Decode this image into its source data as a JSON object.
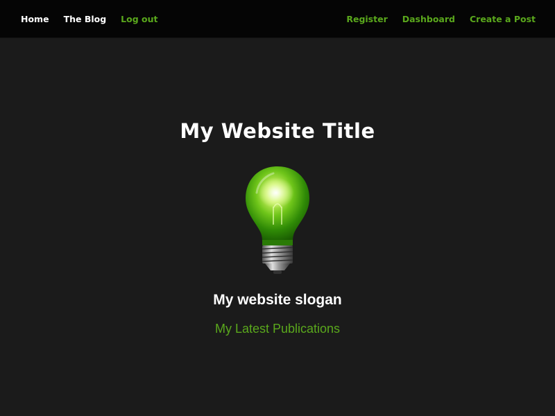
{
  "nav": {
    "left": [
      {
        "label": "Home",
        "color": "#ffffff"
      },
      {
        "label": "The Blog",
        "color": "#ffffff"
      },
      {
        "label": "Log out",
        "color": "#5aa81c"
      }
    ],
    "right": [
      {
        "label": "Register",
        "color": "#5aa81c"
      },
      {
        "label": "Dashboard",
        "color": "#5aa81c"
      },
      {
        "label": "Create a Post",
        "color": "#5aa81c"
      }
    ]
  },
  "hero": {
    "title": "My Website Title",
    "logo_icon": "lightbulb-icon",
    "slogan": "My website slogan",
    "latest_link": "My Latest Publications"
  },
  "colors": {
    "background": "#1b1b1b",
    "navbar": "#050505",
    "accent_green": "#5aa81c",
    "text_white": "#ffffff"
  }
}
